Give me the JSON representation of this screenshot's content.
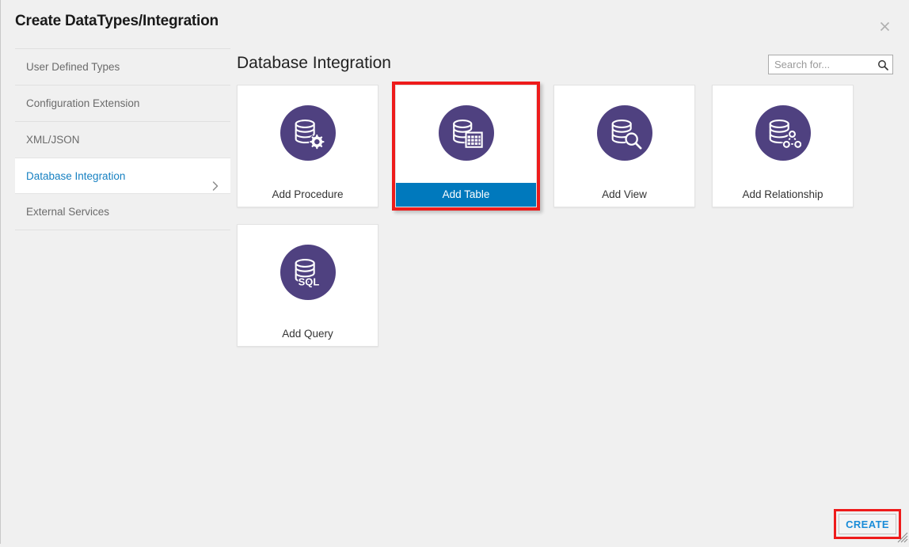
{
  "dialog": {
    "title": "Create DataTypes/Integration",
    "close_label": "×"
  },
  "sidebar": {
    "items": [
      {
        "label": "User Defined Types",
        "selected": false
      },
      {
        "label": "Configuration Extension",
        "selected": false
      },
      {
        "label": "XML/JSON",
        "selected": false
      },
      {
        "label": "Database Integration",
        "selected": true
      },
      {
        "label": "External Services",
        "selected": false
      }
    ]
  },
  "main": {
    "panel_title": "Database Integration",
    "search": {
      "placeholder": "Search for...",
      "value": ""
    },
    "tiles": [
      {
        "label": "Add Procedure",
        "icon": "database-gear-icon",
        "active": false
      },
      {
        "label": "Add Table",
        "icon": "database-grid-icon",
        "active": true
      },
      {
        "label": "Add View",
        "icon": "database-magnifier-icon",
        "active": false
      },
      {
        "label": "Add Relationship",
        "icon": "database-nodes-icon",
        "active": false
      },
      {
        "label": "Add Query",
        "icon": "database-sql-icon",
        "active": false
      }
    ]
  },
  "footer": {
    "create_label": "CREATE"
  },
  "colors": {
    "icon_purple": "#4f4180",
    "active_blue": "#0079bd",
    "link_blue": "#1781c2",
    "highlight_red": "#ee1b1b",
    "background": "#f0f0f0"
  }
}
